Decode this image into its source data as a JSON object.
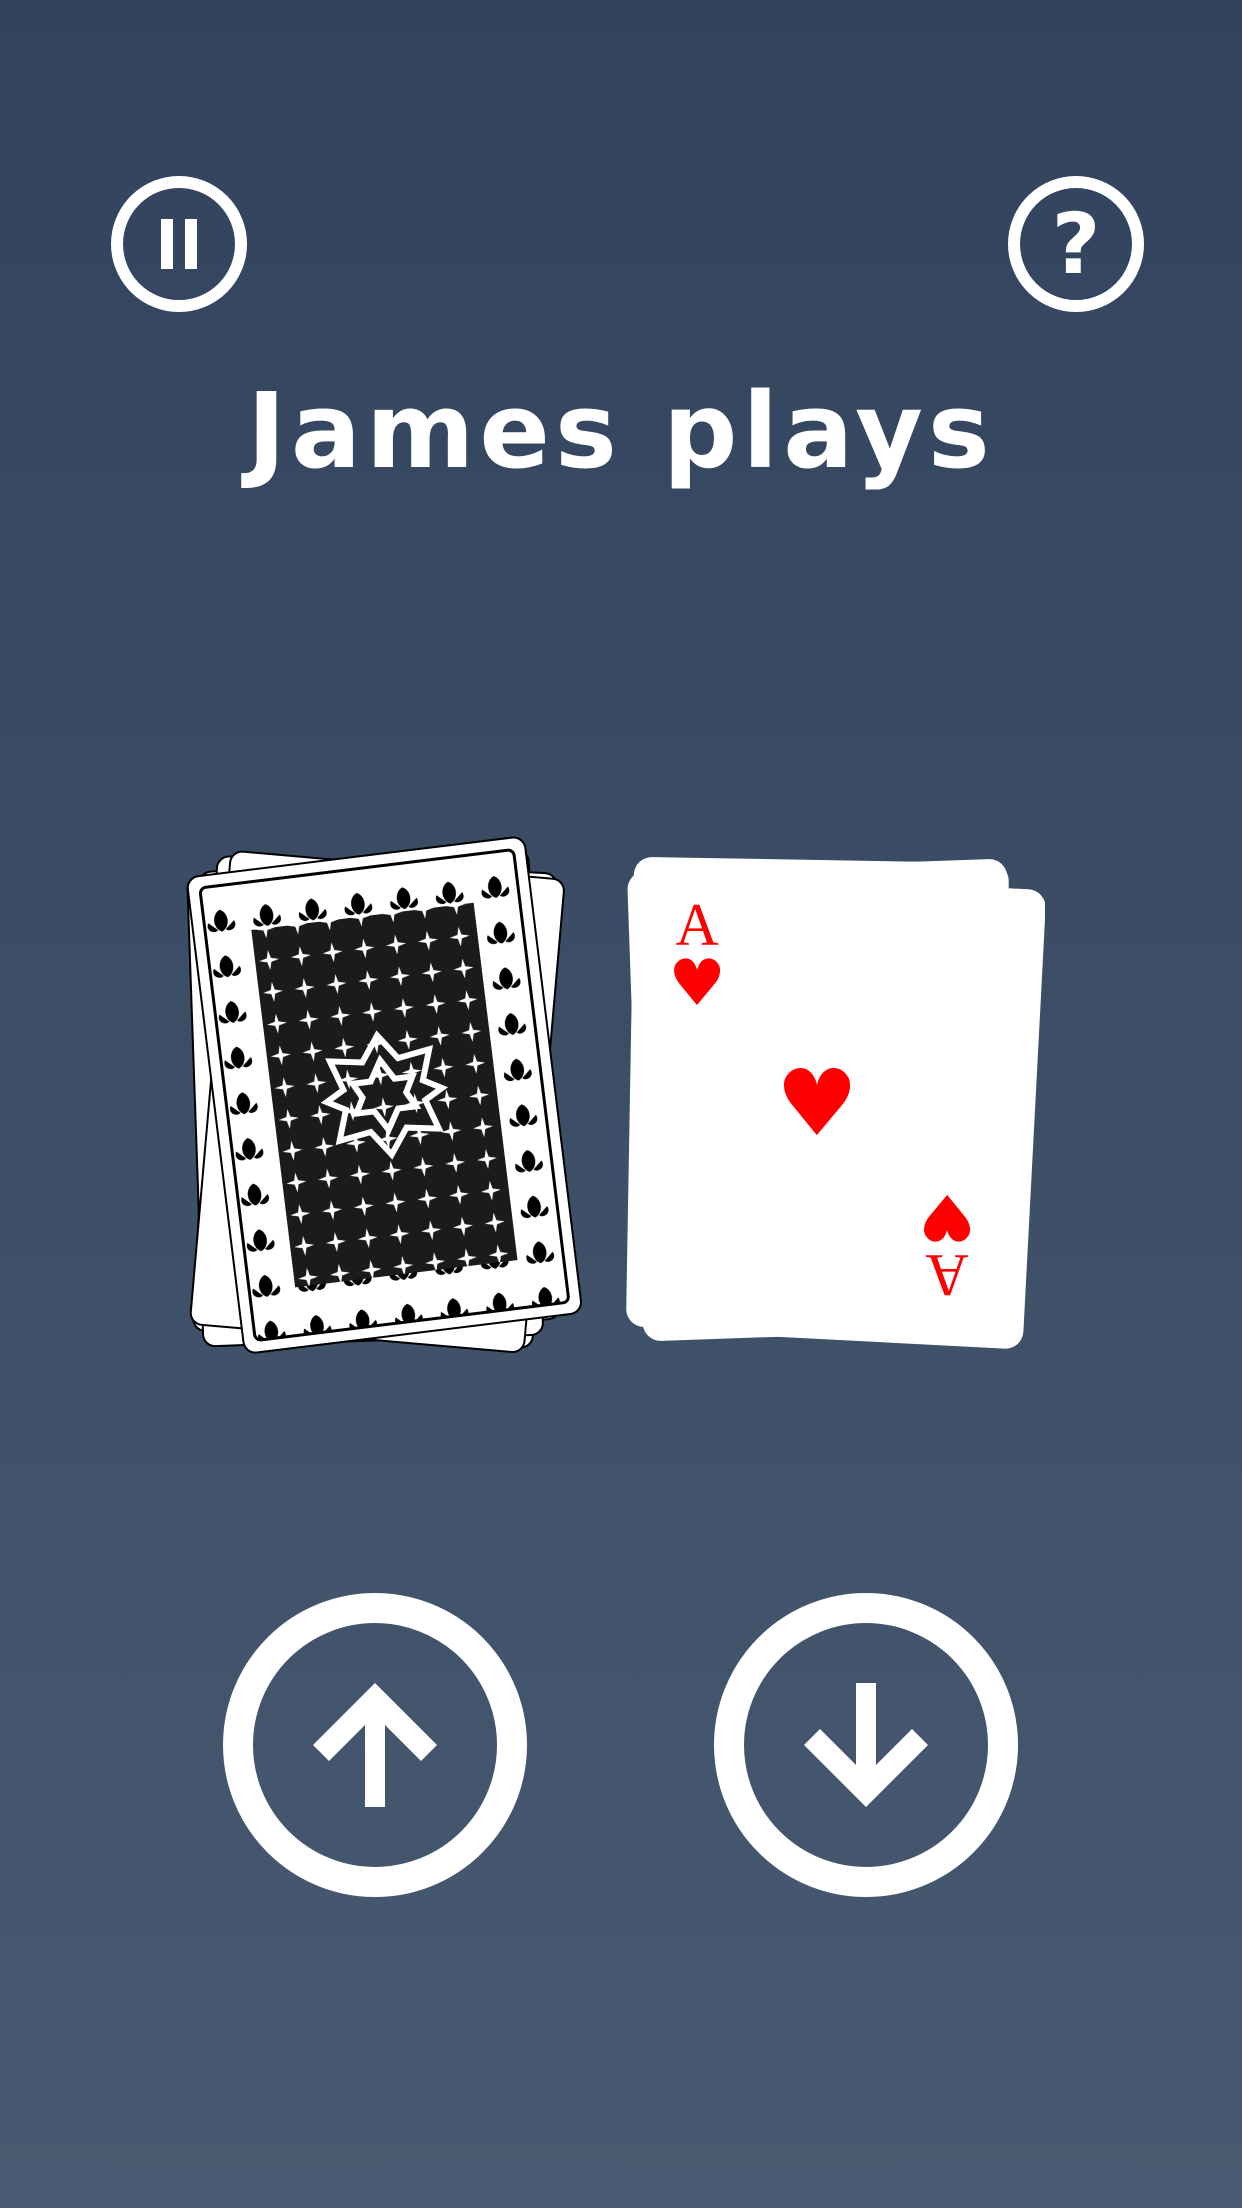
{
  "header": {
    "title": "James plays",
    "pause_icon": "pause-icon",
    "help_icon": "help-icon",
    "help_glyph": "?"
  },
  "table": {
    "deck": {
      "face": "down"
    },
    "played_card": {
      "rank": "A",
      "suit": "hearts",
      "suit_glyph": "♥",
      "color": "#ff0000"
    }
  },
  "controls": {
    "higher_icon": "arrow-up-icon",
    "lower_icon": "arrow-down-icon"
  },
  "colors": {
    "bg_top": "#32445d",
    "bg_bottom": "#485a71",
    "accent": "#ffffff"
  }
}
